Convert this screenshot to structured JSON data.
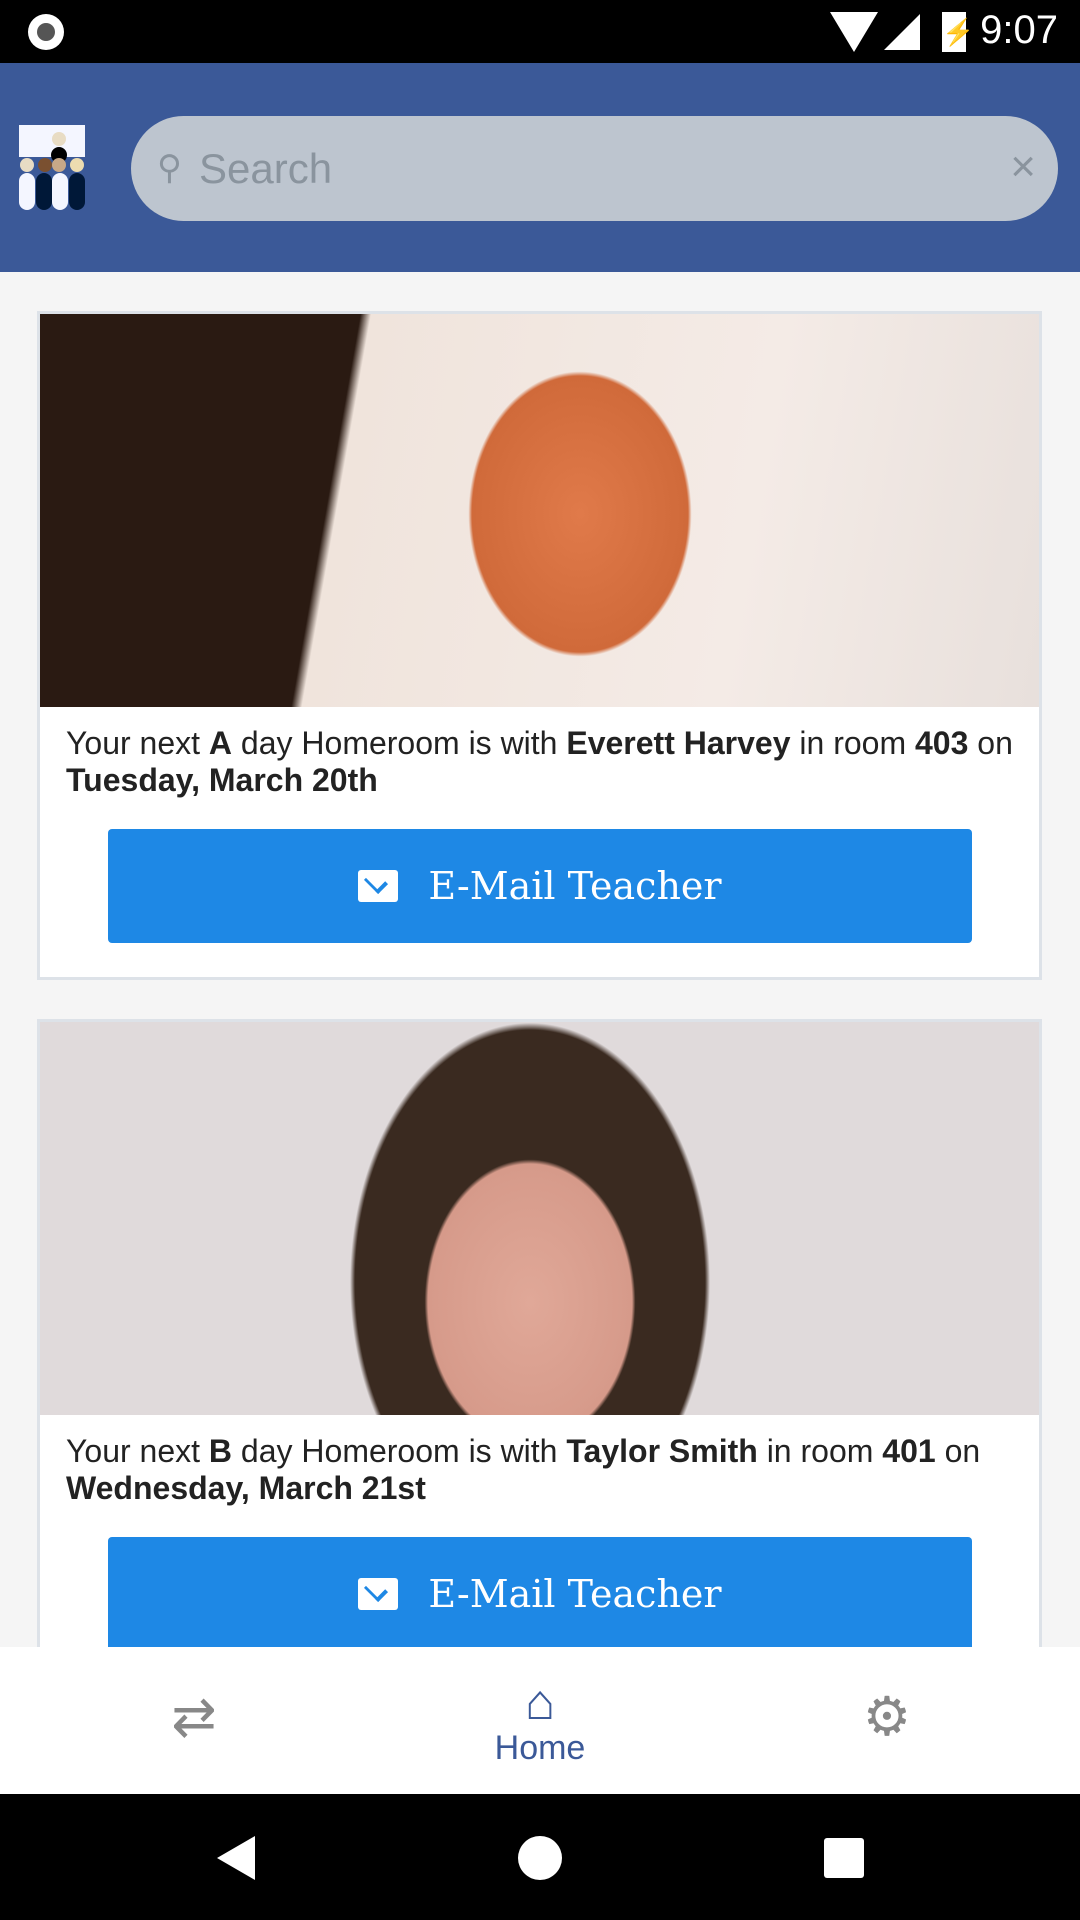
{
  "status_bar": {
    "time": "9:07"
  },
  "search": {
    "placeholder": "Search"
  },
  "cards": [
    {
      "prefix": "Your next ",
      "day": "A",
      "mid1": " day Homeroom is with ",
      "teacher": "Everett Harvey",
      "mid2": " in room ",
      "room": "403",
      "mid3": " on ",
      "date": "Tuesday, March 20th",
      "button": "E-Mail Teacher"
    },
    {
      "prefix": "Your next ",
      "day": "B",
      "mid1": " day Homeroom is with ",
      "teacher": "Taylor Smith",
      "mid2": " in room ",
      "room": "401",
      "mid3": " on ",
      "date": "Wednesday, March 21st",
      "button": "E-Mail Teacher"
    }
  ],
  "bottom_nav": {
    "home_label": "Home"
  },
  "colors": {
    "header": "#3b5998",
    "button": "#1e88e5"
  }
}
